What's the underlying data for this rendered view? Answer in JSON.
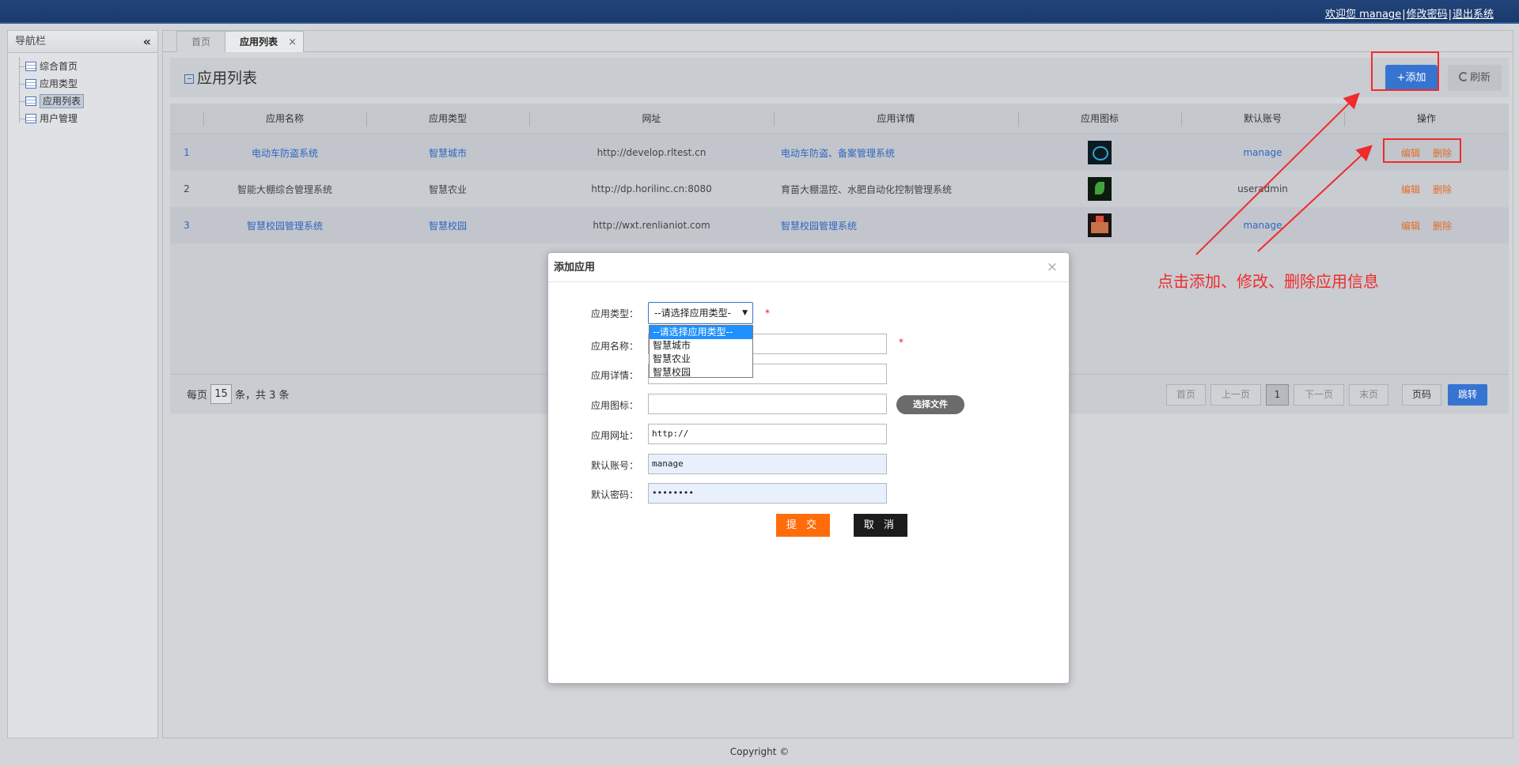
{
  "header": {
    "welcome": "欢迎您 manage",
    "change_password": "修改密码",
    "logout": "退出系统"
  },
  "sidebar": {
    "title": "导航栏",
    "items": [
      {
        "label": "综合首页"
      },
      {
        "label": "应用类型"
      },
      {
        "label": "应用列表"
      },
      {
        "label": "用户管理"
      }
    ]
  },
  "tabs": [
    {
      "label": "首页"
    },
    {
      "label": "应用列表"
    }
  ],
  "page": {
    "title": "应用列表",
    "add_label": "+添加",
    "refresh_label": "刷新"
  },
  "table": {
    "columns": [
      "",
      "应用名称",
      "应用类型",
      "网址",
      "应用详情",
      "应用图标",
      "默认账号",
      "操作"
    ],
    "rows": [
      {
        "index": "1",
        "name": "电动车防盗系统",
        "type": "智慧城市",
        "url": "http://develop.rltest.cn",
        "detail": "电动车防盗、备案管理系统",
        "icon": "scooter-icon",
        "account": "manage",
        "edit": "编辑",
        "delete": "删除"
      },
      {
        "index": "2",
        "name": "智能大棚综合管理系统",
        "type": "智慧农业",
        "url": "http://dp.horilinc.cn:8080",
        "detail": "育苗大棚温控、水肥自动化控制管理系统",
        "icon": "plant-icon",
        "account": "useradmin",
        "edit": "编辑",
        "delete": "删除"
      },
      {
        "index": "3",
        "name": "智慧校园管理系统",
        "type": "智慧校园",
        "url": "http://wxt.renlianiot.com",
        "detail": "智慧校园管理系统",
        "icon": "school-icon",
        "account": "manage",
        "edit": "编辑",
        "delete": "删除"
      }
    ]
  },
  "pager": {
    "per_page_prefix": "每页",
    "per_page": "15",
    "per_page_suffix": "条，共 3 条",
    "first": "首页",
    "prev": "上一页",
    "current": "1",
    "next": "下一页",
    "last": "末页",
    "page_code": "页码",
    "jump": "跳转"
  },
  "footer": {
    "copyright": "Copyright ©"
  },
  "modal": {
    "title": "添加应用",
    "type_label": "应用类型：",
    "type_value": "--请选择应用类型-",
    "type_options": [
      "--请选择应用类型--",
      "智慧城市",
      "智慧农业",
      "智慧校园"
    ],
    "name_label": "应用名称：",
    "detail_label": "应用详情：",
    "icon_label": "应用图标：",
    "file_button": "选择文件",
    "url_label": "应用网址：",
    "url_value": "http://",
    "account_label": "默认账号：",
    "account_value": "manage",
    "password_label": "默认密码：",
    "password_value": "••••••••",
    "required_mark": "*",
    "submit": "提 交",
    "cancel": "取 消"
  },
  "annotation": {
    "text": "点击添加、修改、删除应用信息",
    "color": "#f02b2b"
  }
}
